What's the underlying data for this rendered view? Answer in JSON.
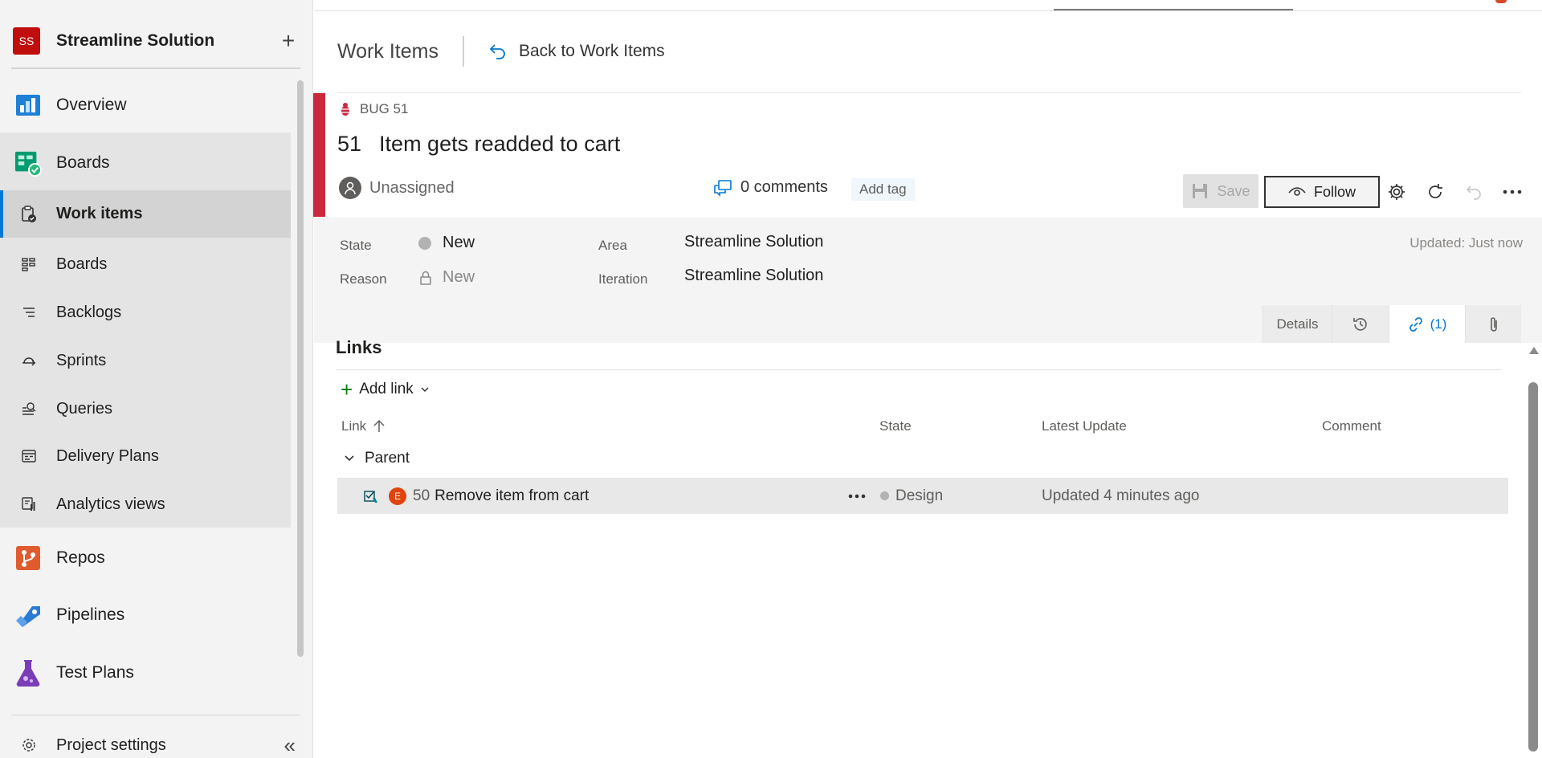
{
  "sidebar": {
    "project_initials": "SS",
    "project_name": "Streamline Solution",
    "add_label": "+",
    "items": [
      {
        "label": "Overview",
        "icon": "overview-icon"
      },
      {
        "label": "Boards",
        "icon": "boards-hub-icon"
      },
      {
        "label": "Work items",
        "icon": "work-items-icon"
      },
      {
        "label": "Boards",
        "icon": "boards-icon"
      },
      {
        "label": "Backlogs",
        "icon": "backlogs-icon"
      },
      {
        "label": "Sprints",
        "icon": "sprints-icon"
      },
      {
        "label": "Queries",
        "icon": "queries-icon"
      },
      {
        "label": "Delivery Plans",
        "icon": "delivery-plans-icon"
      },
      {
        "label": "Analytics views",
        "icon": "analytics-icon"
      },
      {
        "label": "Repos",
        "icon": "repos-icon"
      },
      {
        "label": "Pipelines",
        "icon": "pipelines-icon"
      },
      {
        "label": "Test Plans",
        "icon": "test-plans-icon"
      }
    ],
    "settings_label": "Project settings",
    "collapse_label": "«"
  },
  "header": {
    "title": "Work Items",
    "back_label": "Back to Work Items"
  },
  "work_item": {
    "type_label": "BUG 51",
    "id": "51",
    "title": "Item gets readded to cart",
    "assigned": "Unassigned",
    "comments": "0 comments",
    "add_tag": "Add tag",
    "save_label": "Save",
    "follow_label": "Follow",
    "updated": "Updated: Just now",
    "accent_color": "#cc293d"
  },
  "fields": {
    "state_label": "State",
    "state_value": "New",
    "reason_label": "Reason",
    "reason_value": "New",
    "area_label": "Area",
    "area_value": "Streamline Solution",
    "iteration_label": "Iteration",
    "iteration_value": "Streamline Solution"
  },
  "tabs": {
    "details": "Details",
    "links": "(1)"
  },
  "links": {
    "title": "Links",
    "add_link": "Add link",
    "columns": {
      "link": "Link",
      "state": "State",
      "latest_update": "Latest Update",
      "comment": "Comment"
    },
    "group": "Parent",
    "rows": [
      {
        "badge": "E",
        "id": "50",
        "title": "Remove item from cart",
        "state": "Design",
        "latest_update": "Updated 4 minutes ago",
        "comment": ""
      }
    ]
  }
}
